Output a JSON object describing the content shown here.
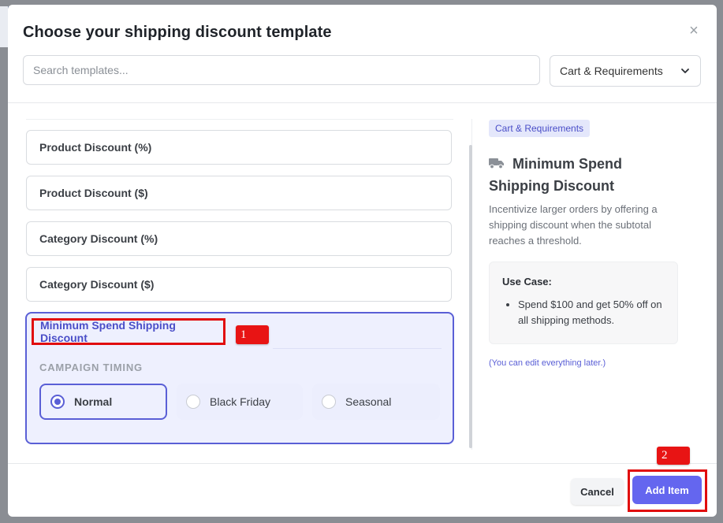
{
  "modal": {
    "title": "Choose your shipping discount template",
    "close_icon": "×"
  },
  "search": {
    "placeholder": "Search templates..."
  },
  "category_select": {
    "selected": "Cart & Requirements",
    "icon": "chevron-down-icon"
  },
  "templates": [
    {
      "label": "Product Discount (%)"
    },
    {
      "label": "Product Discount ($)"
    },
    {
      "label": "Category Discount (%)"
    },
    {
      "label": "Category Discount ($)"
    }
  ],
  "selected_template": {
    "label": "Minimum Spend Shipping Discount",
    "timing_label": "CAMPAIGN TIMING",
    "options": [
      {
        "label": "Normal",
        "selected": true
      },
      {
        "label": "Black Friday",
        "selected": false
      },
      {
        "label": "Seasonal",
        "selected": false
      }
    ]
  },
  "preview": {
    "category_tag": "Cart & Requirements",
    "icon": "truck-icon",
    "title": "Minimum Spend Shipping Discount",
    "description": "Incentivize larger orders by offering a shipping discount when the subtotal reaches a threshold.",
    "use_case_heading": "Use Case:",
    "use_case_items": [
      "Spend $100 and get 50% off on all shipping methods."
    ],
    "edit_note": "(You can edit everything later.)"
  },
  "footer": {
    "cancel_label": "Cancel",
    "add_label": "Add Item"
  },
  "annotations": {
    "badge_1": "1",
    "badge_2": "2"
  },
  "colors": {
    "accent": "#5a5fd6",
    "primary_button": "#6466ef",
    "highlight": "#e10d0d"
  }
}
